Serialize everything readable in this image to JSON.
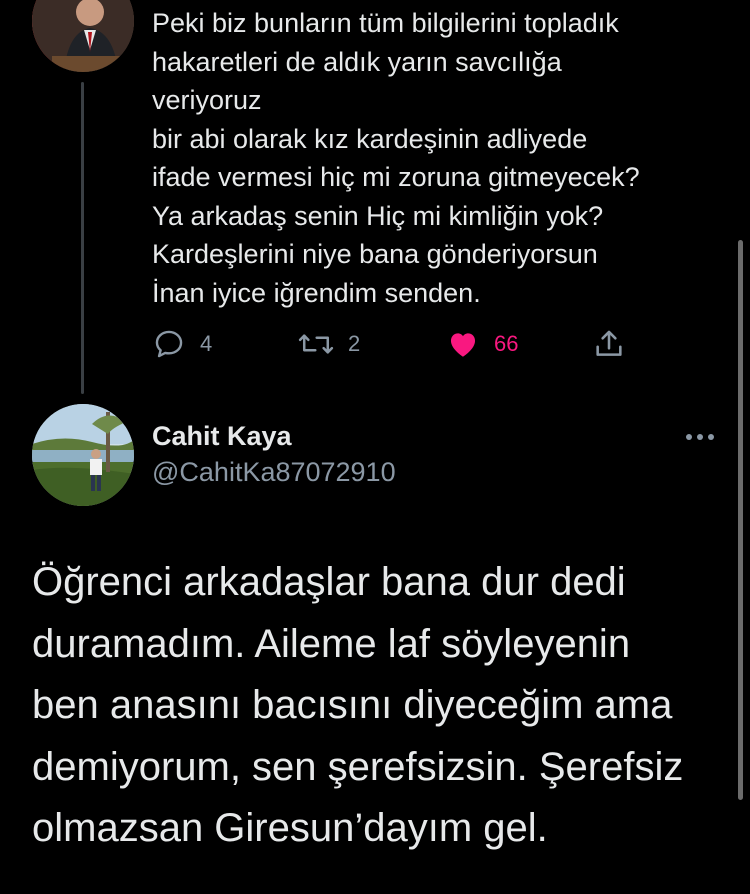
{
  "previous_tweet": {
    "lines": [
      "Peki biz bunların tüm bilgilerini topladık",
      "hakaretleri de aldık yarın savcılığa",
      "veriyoruz",
      "bir abi olarak kız kardeşinin adliyede",
      "ifade vermesi hiç mi zoruna gitmeyecek?",
      "Ya arkadaş senin Hiç mi kimliğin yok?",
      "Kardeşlerini niye bana gönderiyorsun",
      "İnan iyice iğrendim senden."
    ],
    "actions": {
      "reply_count": "4",
      "retweet_count": "2",
      "like_count": "66"
    }
  },
  "tweet": {
    "author_name": "Cahit Kaya",
    "author_handle": "@CahitKa87072910",
    "lines": [
      "Öğrenci arkadaşlar bana dur dedi",
      "duramadım. Aileme laf söyleyenin",
      "ben anasını bacısını diyeceğim ama",
      "demiyorum, sen şerefsizsin. Şerefsiz",
      "olmazsan Giresun’dayım gel."
    ]
  },
  "icons": {
    "reply": "reply-bubble-icon",
    "retweet": "retweet-icon",
    "like": "heart-filled-icon",
    "share": "share-upload-icon",
    "more": "more-dots-icon"
  },
  "colors": {
    "background": "#000000",
    "text": "#e7e9ea",
    "secondary": "#8b98a5",
    "like": "#f91880",
    "thread_line": "#3a3f44"
  }
}
